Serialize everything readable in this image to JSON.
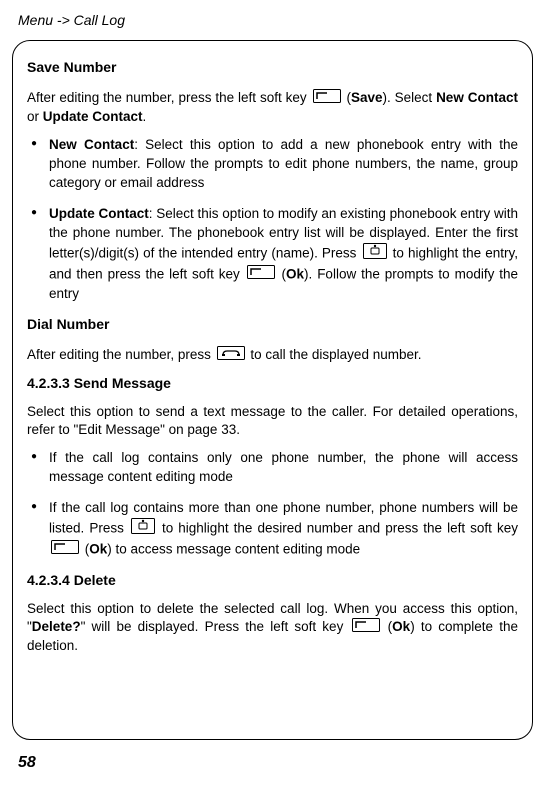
{
  "header": "Menu -> Call Log",
  "save_number": {
    "title": "Save Number",
    "intro_a": "After editing the number, press the left soft key ",
    "intro_b": " (",
    "intro_save": "Save",
    "intro_c": "). Select ",
    "intro_new": "New Contact",
    "intro_or": " or ",
    "intro_update": "Update Contact",
    "intro_end": ".",
    "bullets": {
      "b1_title": "New Contact",
      "b1_text": ": Select this option to add a new phonebook entry with the phone number. Follow the prompts to edit phone numbers, the name, group category or email address",
      "b2_title": "Update Contact",
      "b2_text_a": ": Select this option to modify an existing phonebook entry with the phone number. The phonebook entry list will be displayed. Enter the first letter(s)/digit(s) of the intended entry (name). Press ",
      "b2_text_b": " to highlight the entry, and then press the left soft key ",
      "b2_text_c": " (",
      "b2_ok": "Ok",
      "b2_text_d": "). Follow the prompts to modify the entry"
    }
  },
  "dial_number": {
    "title": "Dial Number",
    "text_a": "After editing the number, press ",
    "text_b": " to call the displayed number."
  },
  "send_message": {
    "heading": "4.2.3.3 Send Message",
    "intro": "Select this option to send a text message to the caller. For detailed operations, refer to \"Edit Message\" on page 33.",
    "bullets": {
      "b1": "If the call log contains only one phone number, the phone will access message content editing mode",
      "b2_a": "If the call log contains more than one phone number, phone numbers will be listed. Press ",
      "b2_b": " to highlight the desired number and press the left soft key ",
      "b2_c": " (",
      "b2_ok": "Ok",
      "b2_d": ") to access message content editing mode"
    }
  },
  "delete": {
    "heading": "4.2.3.4 Delete",
    "text_a": "Select this option to delete the selected call log. When you access this option, \"",
    "text_delete": "Delete?",
    "text_b": "\" will be displayed. Press the left soft key ",
    "text_c": " (",
    "text_ok": "Ok",
    "text_d": ") to complete the deletion."
  },
  "page_number": "58"
}
